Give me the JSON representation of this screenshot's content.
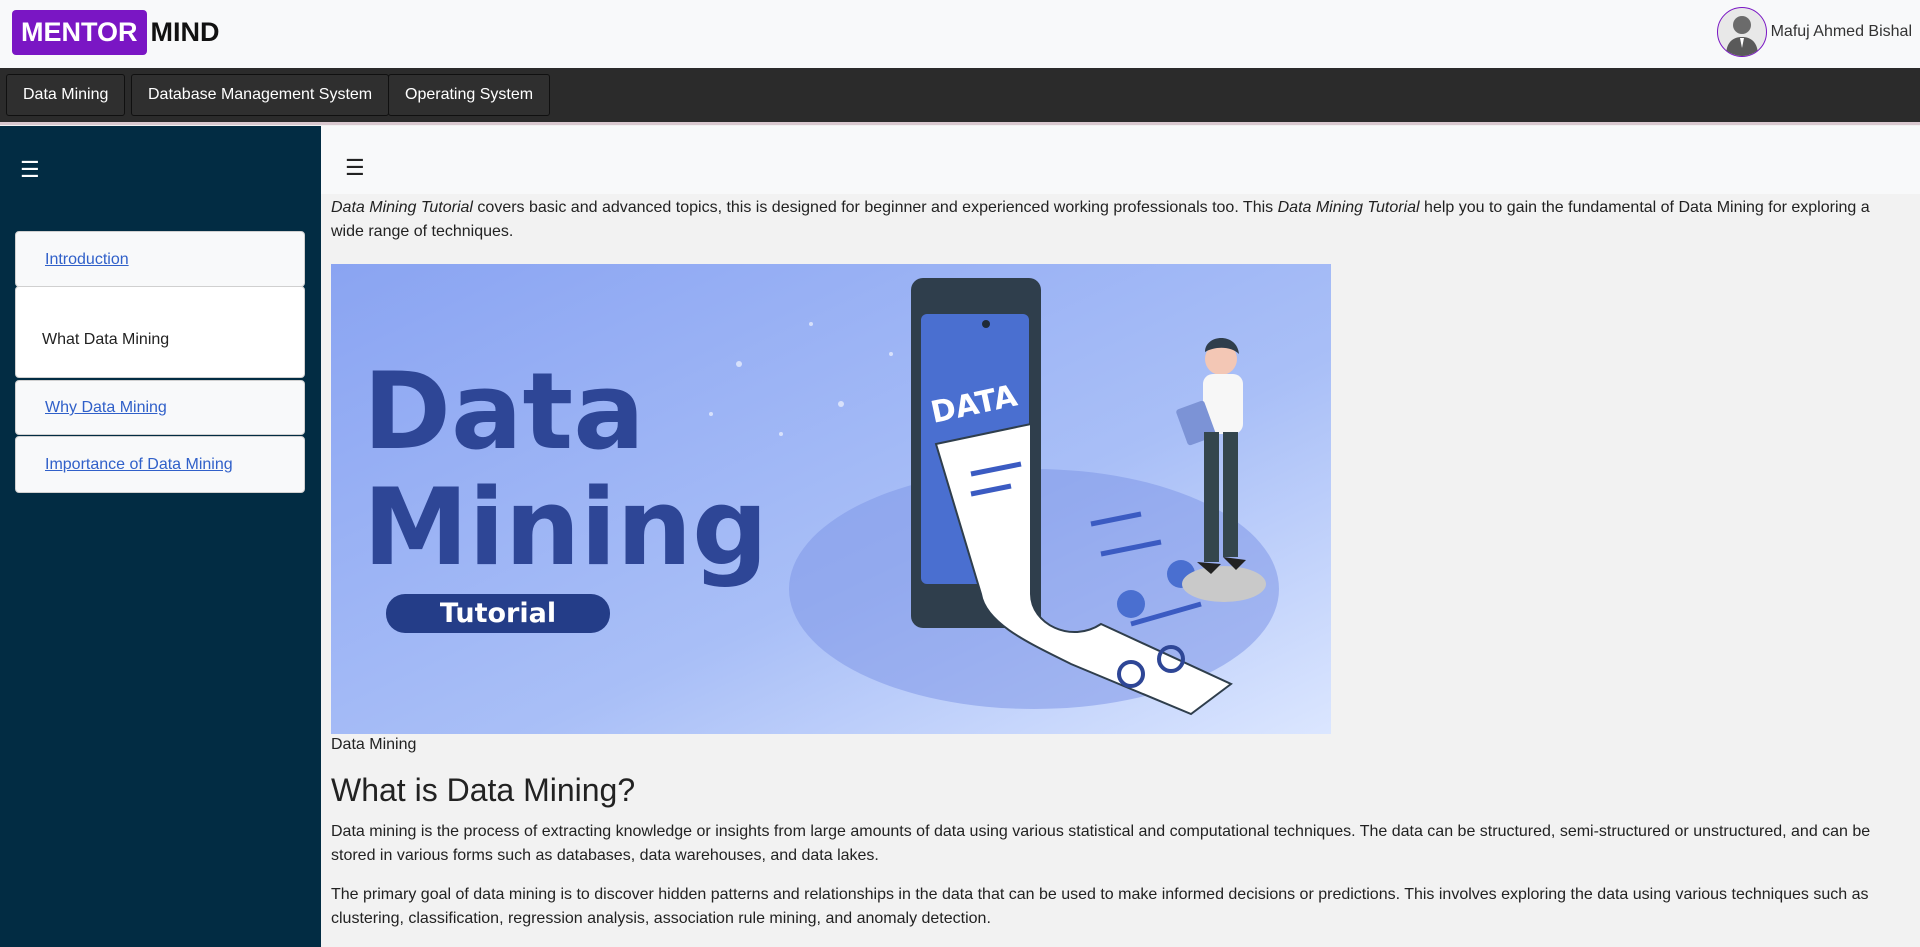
{
  "brand": {
    "part1": "MENTOR",
    "part2": "MIND",
    "accent": "#7a16c4"
  },
  "user": {
    "name": "Mafuj Ahmed Bishal",
    "avatar_icon": "user-avatar-icon"
  },
  "topnav": {
    "items": [
      "Data Mining",
      "Database Management System",
      "Operating System"
    ]
  },
  "sidebar": {
    "toggle_icon": "menu-icon",
    "items": [
      {
        "label": "Introduction",
        "link": true
      },
      {
        "label": "What Data Mining",
        "link": false
      },
      {
        "label": "Why Data Mining",
        "link": true
      },
      {
        "label": "Importance of Data Mining",
        "link": true
      }
    ]
  },
  "main": {
    "toggle_icon": "menu-icon",
    "intro": {
      "em1": "Data Mining Tutorial",
      "text1": " covers basic and advanced topics, this is designed for beginner and experienced working professionals too. This ",
      "em2": "Data Mining Tutorial",
      "text2": " help you to gain the fundamental of Data Mining for exploring a wide range of techniques."
    },
    "hero": {
      "title_line1": "Data",
      "title_line2": "Mining",
      "badge": "Tutorial",
      "phone_label": "DATA"
    },
    "caption": "Data Mining",
    "heading": "What is Data Mining?",
    "para1": "Data mining is the process of extracting knowledge or insights from large amounts of data using various statistical and computational techniques. The data can be structured, semi-structured or unstructured, and can be stored in various forms such as databases, data warehouses, and data lakes.",
    "para2": "The primary goal of data mining is to discover hidden patterns and relationships in the data that can be used to make informed decisions or predictions. This involves exploring the data using various techniques such as clustering, classification, regression analysis, association rule mining, and anomaly detection."
  }
}
